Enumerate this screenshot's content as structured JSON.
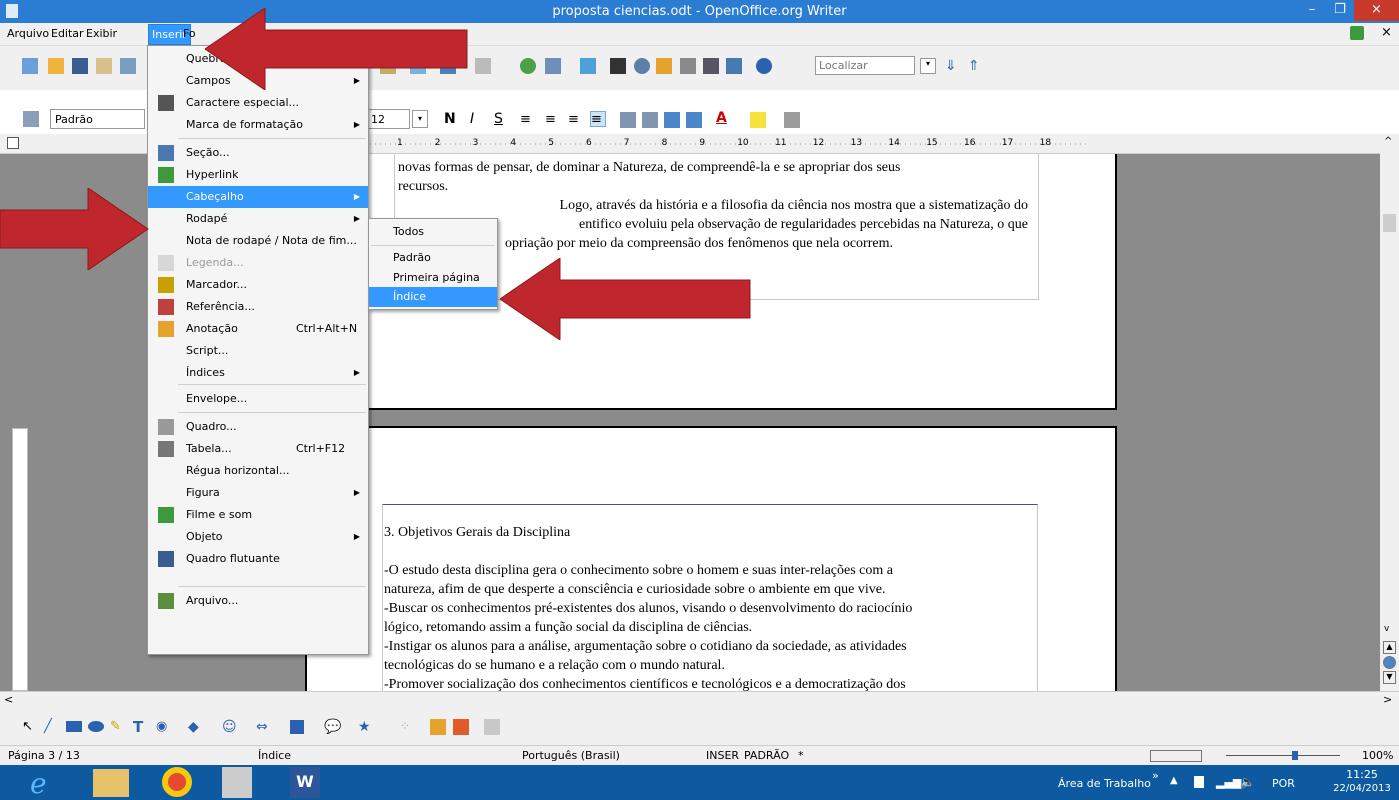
{
  "window": {
    "title": "proposta ciencias.odt - OpenOffice.org Writer",
    "minimize": "–",
    "maximize": "❐",
    "close": "×"
  },
  "menubar": {
    "items": [
      "Arquivo",
      "Editar",
      "Exibir",
      "Inserir",
      "Fo",
      "a"
    ]
  },
  "toolbar": {
    "find_placeholder": "Localizar",
    "style": "Padrão",
    "font_size": "12",
    "bold": "N",
    "italic": "I",
    "underline": "S"
  },
  "ruler": {
    "marks": [
      "1",
      "2",
      "3",
      "4",
      "5",
      "6",
      "7",
      "8",
      "9",
      "10",
      "11",
      "12",
      "13",
      "14",
      "15",
      "16",
      "17",
      "18"
    ]
  },
  "insert_menu": {
    "items": [
      {
        "label": "Quebra manual...",
        "shortcut": "",
        "submenu": false,
        "disabled": false
      },
      {
        "label": "Campos",
        "shortcut": "",
        "submenu": true,
        "disabled": false
      },
      {
        "label": "Caractere especial...",
        "shortcut": "",
        "submenu": false,
        "disabled": false
      },
      {
        "label": "Marca de formatação",
        "shortcut": "",
        "submenu": true,
        "disabled": false
      },
      {
        "label": "Seção...",
        "shortcut": "",
        "submenu": false,
        "disabled": false
      },
      {
        "label": "Hyperlink",
        "shortcut": "",
        "submenu": false,
        "disabled": false
      },
      {
        "label": "Cabeçalho",
        "shortcut": "",
        "submenu": true,
        "disabled": false
      },
      {
        "label": "Rodapé",
        "shortcut": "",
        "submenu": true,
        "disabled": false
      },
      {
        "label": "Nota de rodapé / Nota de fim...",
        "shortcut": "",
        "submenu": false,
        "disabled": false
      },
      {
        "label": "Legenda...",
        "shortcut": "",
        "submenu": false,
        "disabled": true
      },
      {
        "label": "Marcador...",
        "shortcut": "",
        "submenu": false,
        "disabled": false
      },
      {
        "label": "Referência...",
        "shortcut": "",
        "submenu": false,
        "disabled": false
      },
      {
        "label": "Anotação",
        "shortcut": "Ctrl+Alt+N",
        "submenu": false,
        "disabled": false
      },
      {
        "label": "Script...",
        "shortcut": "",
        "submenu": false,
        "disabled": false
      },
      {
        "label": "Índices",
        "shortcut": "",
        "submenu": true,
        "disabled": false
      },
      {
        "label": "Envelope...",
        "shortcut": "",
        "submenu": false,
        "disabled": false
      },
      {
        "label": "Quadro...",
        "shortcut": "",
        "submenu": false,
        "disabled": false
      },
      {
        "label": "Tabela...",
        "shortcut": "Ctrl+F12",
        "submenu": false,
        "disabled": false
      },
      {
        "label": "Régua horizontal...",
        "shortcut": "",
        "submenu": false,
        "disabled": false
      },
      {
        "label": "Figura",
        "shortcut": "",
        "submenu": true,
        "disabled": false
      },
      {
        "label": "Filme e som",
        "shortcut": "",
        "submenu": false,
        "disabled": false
      },
      {
        "label": "Objeto",
        "shortcut": "",
        "submenu": true,
        "disabled": false
      },
      {
        "label": "Quadro flutuante",
        "shortcut": "",
        "submenu": false,
        "disabled": false
      },
      {
        "label": "Arquivo...",
        "shortcut": "",
        "submenu": false,
        "disabled": false
      }
    ]
  },
  "header_submenu": {
    "items": [
      "Todos",
      "Padrão",
      "Primeira página",
      "Índice"
    ]
  },
  "document": {
    "page1_lines": [
      "novas formas de pensar, de dominar a Natureza, de compreendê-la e se apropriar dos seus",
      "recursos.",
      "Logo, através da história e a filosofia da ciência nos mostra que a sistematização do",
      "entifico evoluiu pela observação de regularidades percebidas na Natureza, o que",
      "opriação por meio da compreensão dos fenômenos que nela ocorrem."
    ],
    "page2_heading": "3. Objetivos Gerais da Disciplina",
    "page2_lines": [
      "-O estudo desta disciplina gera o conhecimento sobre o homem e suas inter-relações com a",
      "natureza, afim de que desperte a consciência e curiosidade sobre o ambiente em que vive.",
      "-Buscar os conhecimentos pré-existentes dos alunos, visando o desenvolvimento do raciocínio",
      "lógico, retomando assim a função social da disciplina de ciências.",
      "-Instigar os alunos para a análise, argumentação sobre o cotidiano da sociedade, as atividades",
      "tecnológicas do se humano e a relação com o mundo natural.",
      "-Promover socialização dos conhecimentos científicos e tecnológicos e a democratização dos"
    ]
  },
  "statusbar": {
    "page": "Página 3 / 13",
    "style": "Índice",
    "language": "Português (Brasil)",
    "mode": "INSER",
    "selection": "PADRÃO",
    "modified": "*",
    "zoom": "100%"
  },
  "taskbar": {
    "desktop": "Área de Trabalho",
    "language": "POR",
    "time": "11:25",
    "date": "22/04/2013",
    "chevron": "»"
  },
  "colors": {
    "titlebar": "#2b7cd3",
    "highlight": "#3399ff",
    "arrow": "#c0272d",
    "taskbar": "#0e5aa0"
  }
}
